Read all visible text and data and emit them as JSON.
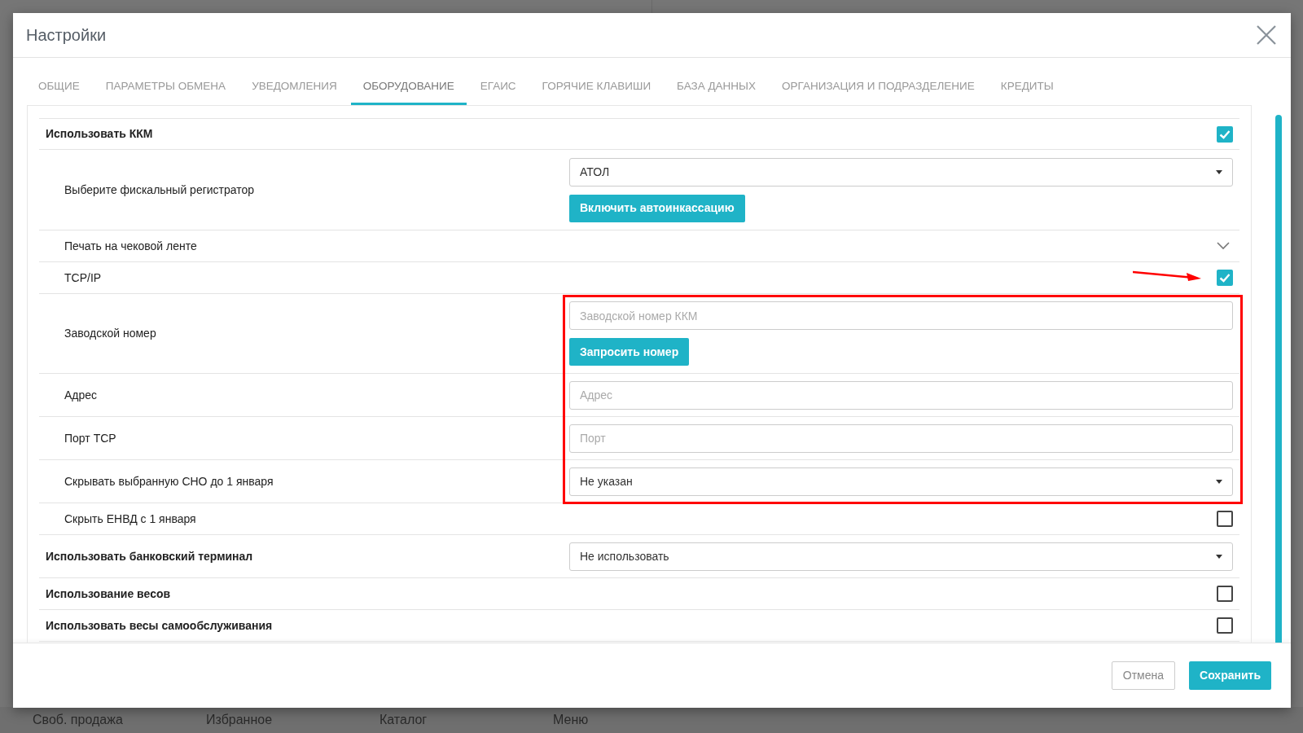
{
  "background_nav": [
    "Своб. продажа",
    "Избранное",
    "Каталог",
    "Меню"
  ],
  "dialog": {
    "title": "Настройки",
    "tabs": [
      {
        "label": "ОБЩИЕ",
        "selected": false
      },
      {
        "label": "ПАРАМЕТРЫ ОБМЕНА",
        "selected": false
      },
      {
        "label": "УВЕДОМЛЕНИЯ",
        "selected": false
      },
      {
        "label": "ОБОРУДОВАНИЕ",
        "selected": true
      },
      {
        "label": "ЕГАИС",
        "selected": false
      },
      {
        "label": "ГОРЯЧИЕ КЛАВИШИ",
        "selected": false
      },
      {
        "label": "БАЗА ДАННЫХ",
        "selected": false
      },
      {
        "label": "ОРГАНИЗАЦИЯ И ПОДРАЗДЕЛЕНИЕ",
        "selected": false
      },
      {
        "label": "КРЕДИТЫ",
        "selected": false
      }
    ],
    "settings": [
      {
        "kind": "checkbox",
        "label": "Использовать ККМ",
        "indented": false,
        "checked": true
      },
      {
        "kind": "select",
        "label": "Выберите фискальный регистратор",
        "indented": true,
        "value": "АТОЛ",
        "button": "Включить автоинкассацию"
      },
      {
        "kind": "expander",
        "label": "Печать на чековой ленте",
        "indented": true,
        "expanded": false
      },
      {
        "kind": "checkbox",
        "label": "TCP/IP",
        "indented": true,
        "checked": true,
        "annotated": true
      },
      {
        "kind": "input",
        "label": "Заводской номер",
        "indented": true,
        "placeholder": "Заводской номер ККМ",
        "button": "Запросить номер",
        "highlighted": true
      },
      {
        "kind": "input",
        "label": "Адрес",
        "indented": true,
        "placeholder": "Адрес",
        "highlighted": true
      },
      {
        "kind": "input",
        "label": "Порт TCP",
        "indented": true,
        "placeholder": "Порт",
        "highlighted": true
      },
      {
        "kind": "select",
        "label": "Скрывать выбранную СНО до 1 января",
        "indented": true,
        "value": "Не указан",
        "highlighted": true
      },
      {
        "kind": "checkbox",
        "label": "Скрыть ЕНВД с 1 января",
        "indented": true,
        "checked": false
      },
      {
        "kind": "select",
        "label": "Использовать банковский терминал",
        "indented": false,
        "value": "Не использовать"
      },
      {
        "kind": "checkbox",
        "label": "Использование весов",
        "indented": false,
        "checked": false
      },
      {
        "kind": "checkbox",
        "label": "Использовать весы самообслуживания",
        "indented": false,
        "checked": false
      }
    ],
    "buttons": {
      "cancel": "Отмена",
      "save": "Сохранить"
    }
  }
}
